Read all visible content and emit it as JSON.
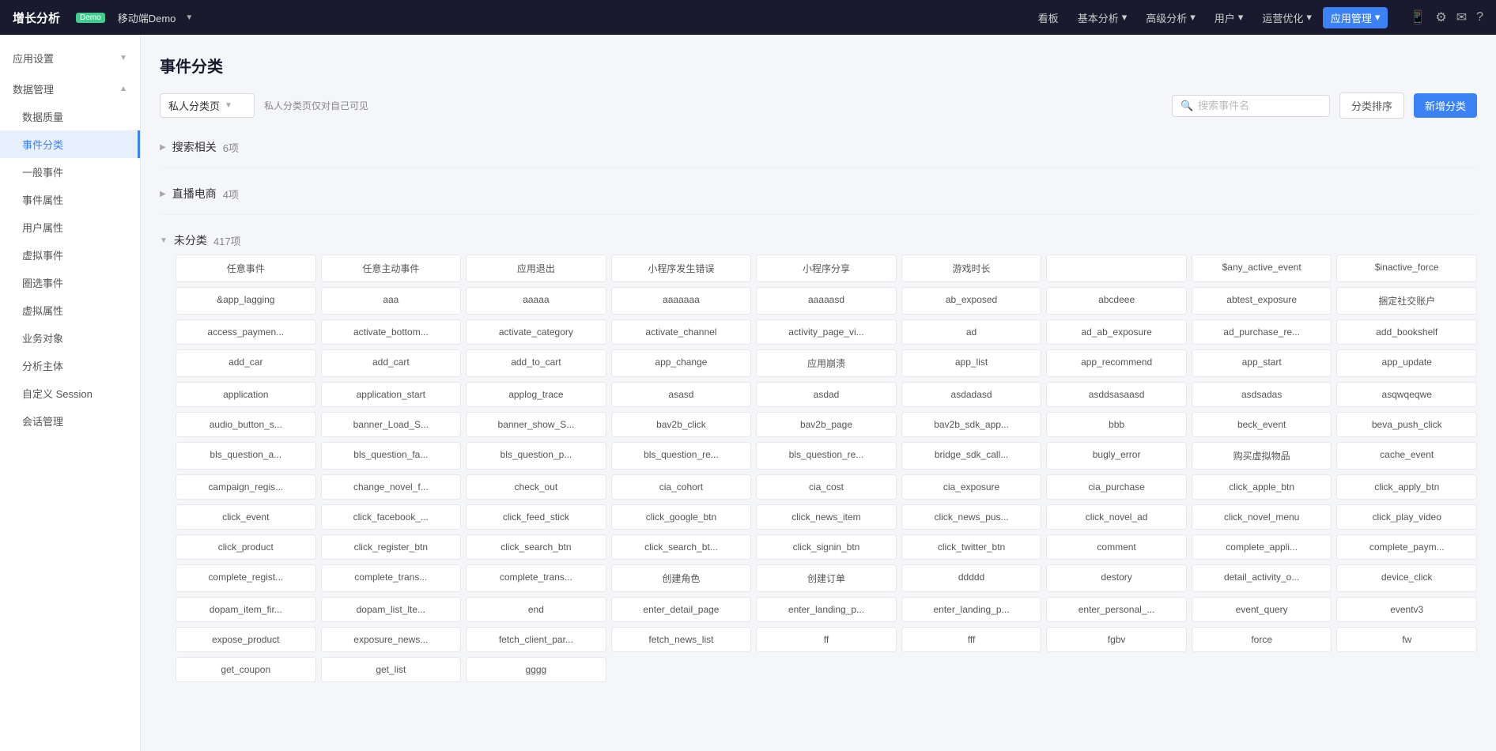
{
  "app": {
    "title": "增长分析",
    "demo_badge": "Demo",
    "app_name": "移动端Demo"
  },
  "nav": {
    "items": [
      {
        "label": "看板",
        "active": false,
        "has_dropdown": false
      },
      {
        "label": "基本分析",
        "active": false,
        "has_dropdown": true
      },
      {
        "label": "高级分析",
        "active": false,
        "has_dropdown": true
      },
      {
        "label": "用户",
        "active": false,
        "has_dropdown": true
      },
      {
        "label": "运营优化",
        "active": false,
        "has_dropdown": true
      },
      {
        "label": "应用管理",
        "active": true,
        "has_dropdown": true
      }
    ]
  },
  "sidebar": {
    "sections": [
      {
        "label": "应用设置",
        "collapsed": false,
        "items": []
      },
      {
        "label": "数据管理",
        "collapsed": false,
        "items": [
          {
            "label": "数据质量",
            "active": false
          },
          {
            "label": "事件分类",
            "active": true
          },
          {
            "label": "一般事件",
            "active": false
          },
          {
            "label": "事件属性",
            "active": false
          },
          {
            "label": "用户属性",
            "active": false
          },
          {
            "label": "虚拟事件",
            "active": false
          },
          {
            "label": "圈选事件",
            "active": false
          },
          {
            "label": "虚拟属性",
            "active": false
          },
          {
            "label": "业务对象",
            "active": false
          },
          {
            "label": "分析主体",
            "active": false
          },
          {
            "label": "自定义 Session",
            "active": false
          },
          {
            "label": "会话管理",
            "active": false
          }
        ]
      }
    ]
  },
  "page": {
    "title": "事件分类",
    "filter": {
      "dropdown_value": "私人分类页",
      "dropdown_note": "私人分类页仅对自己可见",
      "search_placeholder": "搜索事件名",
      "btn_sort": "分类排序",
      "btn_new": "新增分类"
    },
    "categories": [
      {
        "label": "搜索相关",
        "count": "6项",
        "collapsed": true,
        "tags": []
      },
      {
        "label": "直播电商",
        "count": "4项",
        "collapsed": true,
        "tags": []
      },
      {
        "label": "未分类",
        "count": "417项",
        "collapsed": false,
        "tags": [
          "任意事件",
          "任意主动事件",
          "应用退出",
          "小程序发生错误",
          "小程序分享",
          "游戏时长",
          "",
          "$any_active_event",
          "$inactive_force",
          "&app_lagging",
          "aaa",
          "aaaaa",
          "aaaaaaa",
          "aaaaasd",
          "ab_exposed",
          "abcdeee",
          "abtest_exposure",
          "捆定社交账户",
          "access_paymen...",
          "activate_bottom...",
          "activate_category",
          "activate_channel",
          "activity_page_vi...",
          "ad",
          "ad_ab_exposure",
          "ad_purchase_re...",
          "add_bookshelf",
          "add_car",
          "add_cart",
          "add_to_cart",
          "app_change",
          "应用崩溃",
          "app_list",
          "app_recommend",
          "app_start",
          "app_update",
          "application",
          "application_start",
          "applog_trace",
          "asasd",
          "asdad",
          "asdadasd",
          "asddsasaasd",
          "asdsadas",
          "asqwqeqwe",
          "audio_button_s...",
          "banner_Load_S...",
          "banner_show_S...",
          "bav2b_click",
          "bav2b_page",
          "bav2b_sdk_app...",
          "bbb",
          "beck_event",
          "beva_push_click",
          "bls_question_a...",
          "bls_question_fa...",
          "bls_question_p...",
          "bls_question_re...",
          "bls_question_re...",
          "bridge_sdk_call...",
          "bugly_error",
          "购买虚拟物品",
          "cache_event",
          "campaign_regis...",
          "change_novel_f...",
          "check_out",
          "cia_cohort",
          "cia_cost",
          "cia_exposure",
          "cia_purchase",
          "click_apple_btn",
          "click_apply_btn",
          "click_event",
          "click_facebook_...",
          "click_feed_stick",
          "click_google_btn",
          "click_news_item",
          "click_news_pus...",
          "click_novel_ad",
          "click_novel_menu",
          "click_play_video",
          "click_product",
          "click_register_btn",
          "click_search_btn",
          "click_search_bt...",
          "click_signin_btn",
          "click_twitter_btn",
          "comment",
          "complete_appli...",
          "complete_paym...",
          "complete_regist...",
          "complete_trans...",
          "complete_trans...",
          "创建角色",
          "创建订单",
          "ddddd",
          "destory",
          "detail_activity_o...",
          "device_click",
          "dopam_item_fir...",
          "dopam_list_lte...",
          "end",
          "enter_detail_page",
          "enter_landing_p...",
          "enter_landing_p...",
          "enter_personal_...",
          "event_query",
          "eventv3",
          "expose_product",
          "exposure_news...",
          "fetch_client_par...",
          "fetch_news_list",
          "ff",
          "fff",
          "fgbv",
          "force",
          "fw",
          "get_coupon",
          "get_list",
          "gggg"
        ]
      }
    ]
  }
}
